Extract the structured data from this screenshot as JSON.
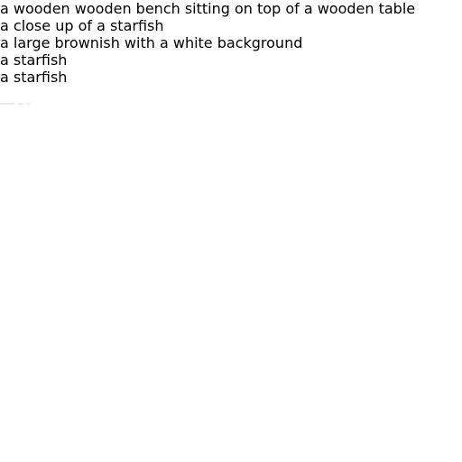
{
  "captions": [
    "a wooden wooden bench sitting on top of a wooden table",
    "a close up of a starfish",
    "a large brownish with a white background",
    "a starfish",
    "a starfish"
  ]
}
